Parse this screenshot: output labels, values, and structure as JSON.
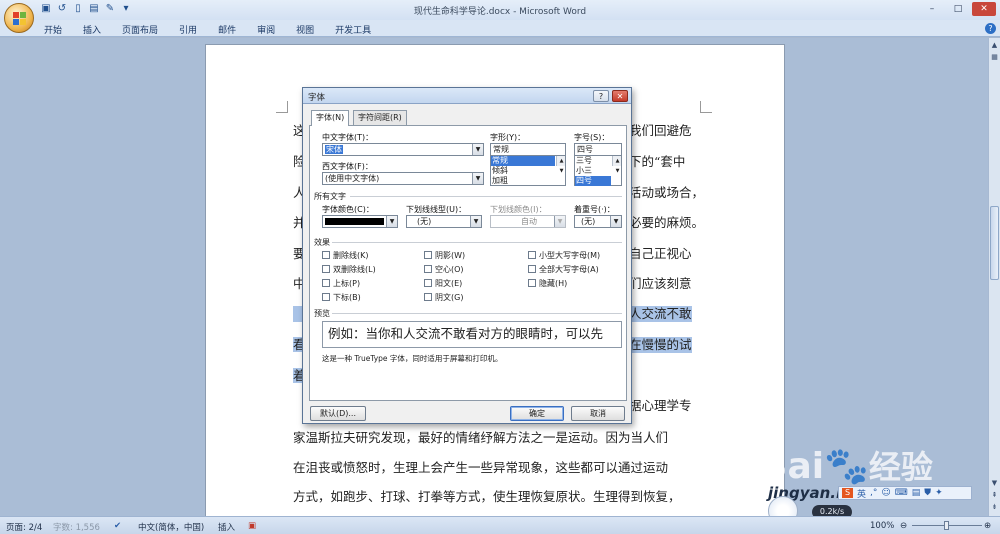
{
  "window": {
    "title": "现代生命科学导论.docx - Microsoft Word",
    "controls": {
      "minimize": "–",
      "maximize": "□",
      "close": "✕"
    }
  },
  "quick_access": [
    "save-icon",
    "undo-icon",
    "new-doc-icon",
    "print-icon",
    "format-painter-icon",
    "customize-icon"
  ],
  "ribbon": {
    "tabs": [
      "开始",
      "插入",
      "页面布局",
      "引用",
      "邮件",
      "审阅",
      "视图",
      "开发工具"
    ],
    "help": "?"
  },
  "document": {
    "lines": [
      {
        "left": "这",
        "right": "我们回避危"
      },
      {
        "left": "险",
        "right": "下的“套中"
      },
      {
        "left": "人",
        "right": "活动或场合，"
      },
      {
        "left": "并",
        "right": "必要的麻烦。"
      },
      {
        "left": "要",
        "right": "自己正视心"
      },
      {
        "left": "中",
        "right": "们应该刻意"
      },
      {
        "left": "",
        "right": "人交流不敢"
      },
      {
        "left": "看",
        "right": "在慢慢的试"
      },
      {
        "left": "着",
        "right": ""
      },
      {
        "left": "",
        "right": "据心理学专"
      },
      {
        "full": "家温斯拉夫研究发现，最好的情绪纾解方法之一是运动。因为当人们"
      },
      {
        "full": "在沮丧或愤怒时，生理上会产生一些异常现象，这些都可以通过运动"
      },
      {
        "full": "方式，如跑步、打球、打拳等方式，使生理恢复原状。生理得到恢复，"
      }
    ]
  },
  "dialog": {
    "title": "字体",
    "title_help": "?",
    "title_close": "✕",
    "tabs": [
      "字体(N)",
      "字符间距(R)"
    ],
    "labels": {
      "chinese_font": "中文字体(T)：",
      "western_font": "西文字体(F)：",
      "style": "字形(Y)：",
      "size": "字号(S)：",
      "all_text": "所有文字",
      "font_color": "字体颜色(C)：",
      "underline_type": "下划线线型(U)：",
      "underline_color": "下划线颜色(I)：",
      "emphasis": "着重号(·)：",
      "effects": "效果",
      "preview": "预览"
    },
    "chinese_font_value": "宋体",
    "western_font_value": "(使用中文字体)",
    "style_value": "常规",
    "style_list": [
      "常规",
      "倾斜",
      "加粗"
    ],
    "size_value": "四号",
    "size_list": [
      "三号",
      "小三",
      "四号"
    ],
    "underline_type_value": "(无)",
    "underline_color_value": "自动",
    "emphasis_value": "(无)",
    "effects": {
      "col1": [
        "删除线(K)",
        "双删除线(L)",
        "上标(P)",
        "下标(B)"
      ],
      "col2": [
        "阴影(W)",
        "空心(O)",
        "阳文(E)",
        "阴文(G)"
      ],
      "col3": [
        "小型大写字母(M)",
        "全部大写字母(A)",
        "隐藏(H)"
      ]
    },
    "preview_text": "例如：当你和人交流不敢看对方的眼睛时，可以先",
    "note": "这是一种 TrueType 字体，同时适用于屏幕和打印机。",
    "buttons": {
      "default": "默认(D)...",
      "ok": "确定",
      "cancel": "取消"
    }
  },
  "statusbar": {
    "page": "页面: 2/4",
    "words": "字数: 1,556",
    "language": "中文(简体，中国)",
    "mode": "插入",
    "zoom": "100%",
    "net_speed": "0.2k/s"
  },
  "watermark": {
    "brand": "Bai",
    "brand2": "经验",
    "site": "jingyan.baidu.com"
  }
}
